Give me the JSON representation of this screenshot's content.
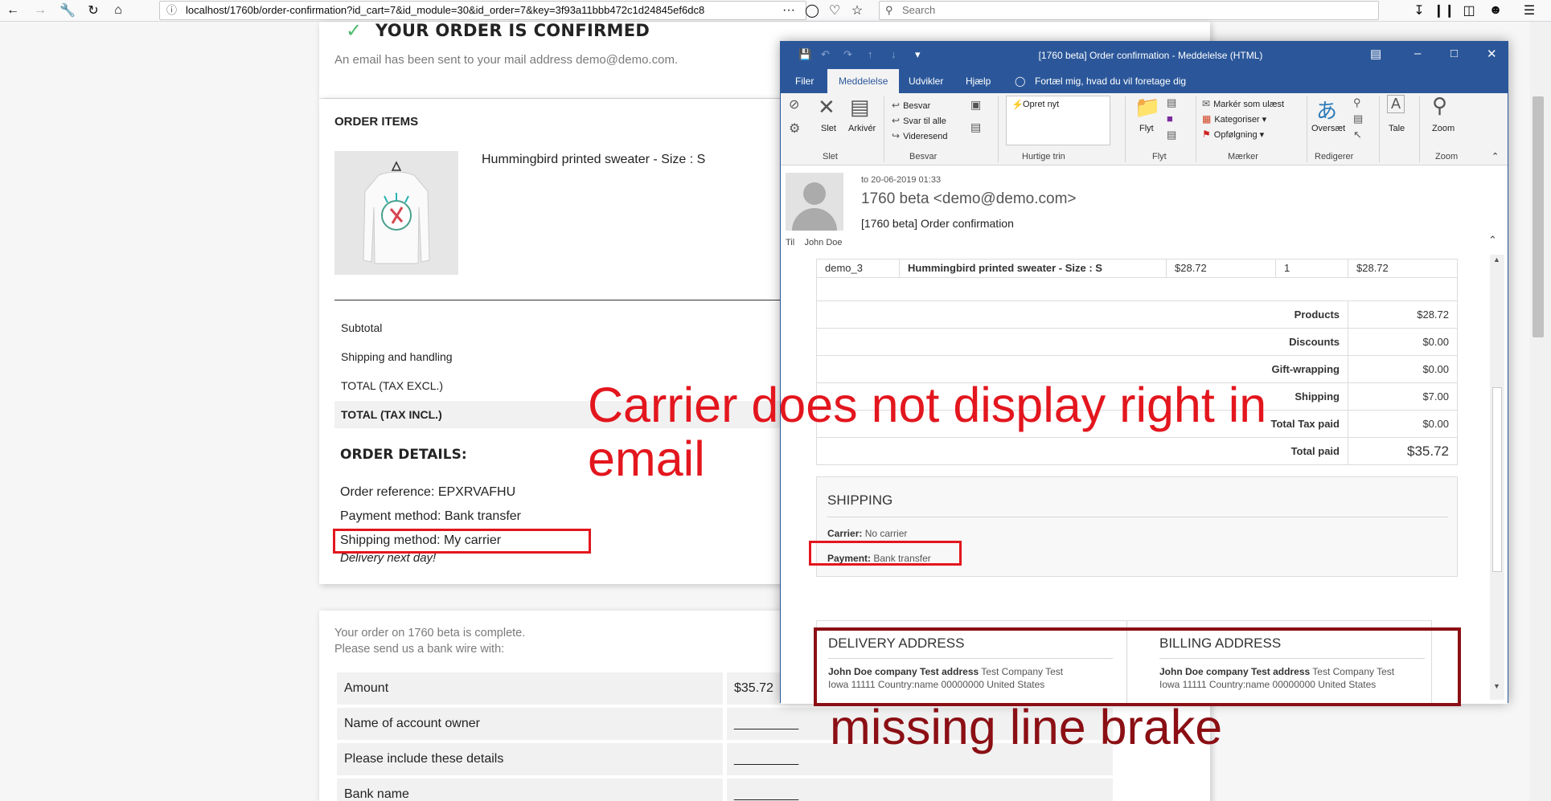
{
  "browser": {
    "url": "localhost/1760b/order-confirmation?id_cart=7&id_module=30&id_order=7&key=3f93a11bbb472c1d24845ef6dc8",
    "search_placeholder": "Search",
    "more_icon": "···"
  },
  "page": {
    "confirm_title": "YOUR ORDER IS CONFIRMED",
    "email_sent": "An email has been sent to your mail address demo@demo.com.",
    "order_items_title": "ORDER ITEMS",
    "product_name": "Hummingbird printed sweater - Size : S",
    "summary": [
      {
        "label": "Subtotal"
      },
      {
        "label": "Shipping and handling"
      },
      {
        "label": "TOTAL (TAX EXCL.)"
      },
      {
        "label": "TOTAL (TAX INCL.)"
      }
    ],
    "order_details_title": "ORDER DETAILS:",
    "order_reference": "Order reference: EPXRVAFHU",
    "payment_method": "Payment method: Bank transfer",
    "shipping_method": "Shipping method: My carrier",
    "delivery_note": "Delivery next day!",
    "bank_intro_1": "Your order on 1760 beta is complete.",
    "bank_intro_2": "Please send us a bank wire with:",
    "bank_rows": [
      {
        "label": "Amount",
        "value": "$35.72"
      },
      {
        "label": "Name of account owner",
        "value": "_________"
      },
      {
        "label": "Please include these details",
        "value": "_________"
      },
      {
        "label": "Bank name",
        "value": "_________"
      }
    ]
  },
  "outlook": {
    "window_title": "[1760 beta] Order confirmation  -  Meddelelse (HTML)",
    "tabs": [
      "Filer",
      "Meddelelse",
      "Udvikler",
      "Hjælp"
    ],
    "tell_me": "Fortæl mig, hvad du vil foretage dig",
    "ribbon": {
      "slet": "Slet",
      "arkiver": "Arkivér",
      "besvar": "Besvar",
      "svar_til_alle": "Svar til alle",
      "videresend": "Videresend",
      "opret_nyt": "Opret nyt",
      "flyt": "Flyt",
      "marker_som_laest": "Markér som ulæst",
      "kategoriser": "Kategoriser",
      "opfolgning": "Opfølgning",
      "oversaet": "Oversæt",
      "tale": "Tale",
      "zoom": "Zoom",
      "groups": {
        "slet": "Slet",
        "besvar": "Besvar",
        "hurtige_trin": "Hurtige trin",
        "flyt": "Flyt",
        "maerker": "Mærker",
        "rediger": "Redigerer",
        "zoom": "Zoom"
      }
    },
    "header": {
      "date": "to 20-06-2019 01:33",
      "from": "1760 beta <demo@demo.com>",
      "subject": "[1760 beta] Order confirmation",
      "to_label": "Til",
      "to_name": "John Doe"
    },
    "email": {
      "item_row": [
        "demo_3",
        "Hummingbird printed sweater - Size : S",
        "$28.72",
        "1",
        "$28.72"
      ],
      "totals": [
        {
          "label": "Products",
          "value": "$28.72"
        },
        {
          "label": "Discounts",
          "value": "$0.00"
        },
        {
          "label": "Gift-wrapping",
          "value": "$0.00"
        },
        {
          "label": "Shipping",
          "value": "$7.00"
        },
        {
          "label": "Total Tax paid",
          "value": "$0.00"
        },
        {
          "label": "Total paid",
          "value": "$35.72"
        }
      ],
      "shipping_title": "SHIPPING",
      "carrier_label": "Carrier:",
      "carrier_value": "No carrier",
      "payment_label": "Payment:",
      "payment_value": "Bank transfer",
      "delivery_title": "DELIVERY ADDRESS",
      "billing_title": "BILLING ADDRESS",
      "address_bold": "John Doe company Test address",
      "address_rest": "Test Company Test",
      "address_line2": "Iowa 11111 Country:name 00000000 United States"
    }
  },
  "annotations": {
    "carrier_note": "Carrier does not display right in email",
    "line_break_note": "missing line brake"
  },
  "colors": {
    "outlook_blue": "#2b579a",
    "annotation_red": "#e3161e",
    "annotation_dark_red": "#8b0f14"
  }
}
